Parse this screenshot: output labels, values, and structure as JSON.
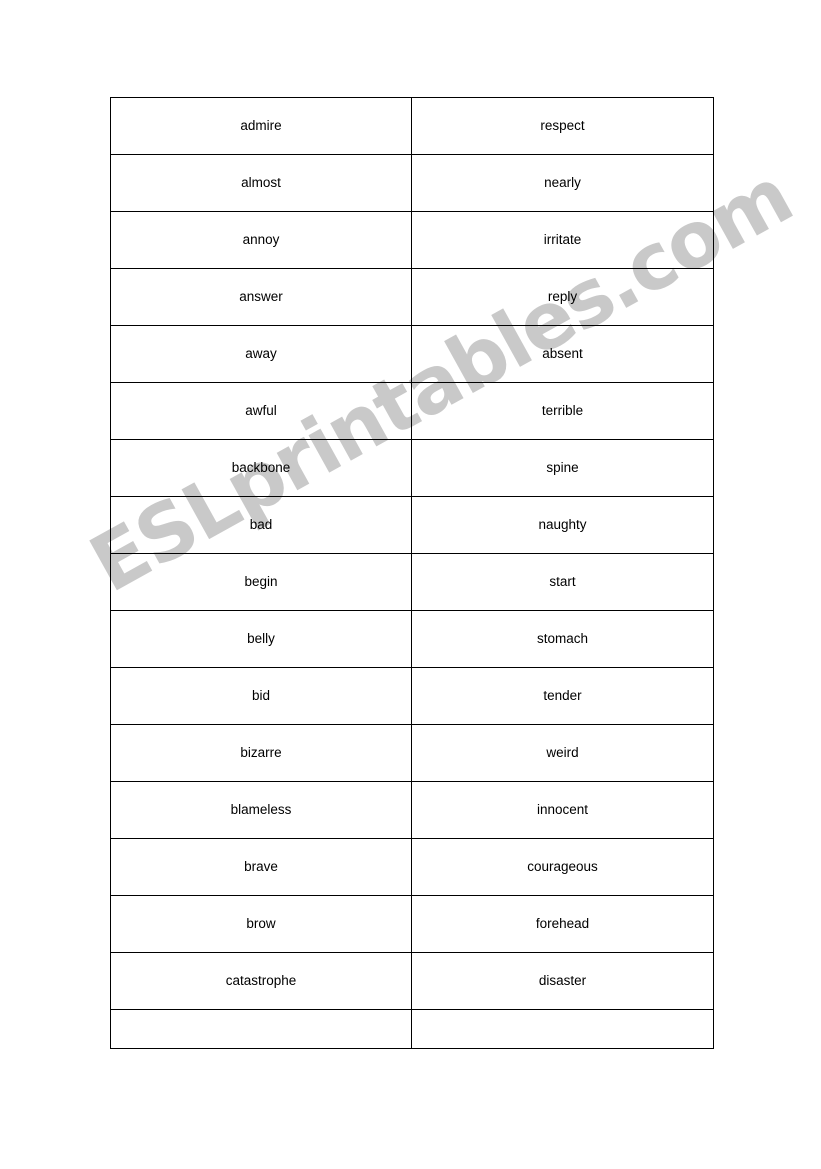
{
  "document": {
    "kind": "esl-worksheet",
    "background_color": "#ffffff",
    "text_color": "#000000",
    "border_color": "#000000"
  },
  "watermark": {
    "text": "ESLprintables.com",
    "color": "#c9c9c9",
    "rotation_degrees": -29
  },
  "table": {
    "columns": 2,
    "column_headers": [
      "",
      ""
    ],
    "rows": [
      {
        "left": "admire",
        "right": "respect"
      },
      {
        "left": "almost",
        "right": "nearly"
      },
      {
        "left": "annoy",
        "right": "irritate"
      },
      {
        "left": "answer",
        "right": "reply"
      },
      {
        "left": "away",
        "right": "absent"
      },
      {
        "left": "awful",
        "right": "terrible"
      },
      {
        "left": "backbone",
        "right": "spine"
      },
      {
        "left": "bad",
        "right": "naughty"
      },
      {
        "left": "begin",
        "right": "start"
      },
      {
        "left": "belly",
        "right": "stomach"
      },
      {
        "left": "bid",
        "right": "tender"
      },
      {
        "left": "bizarre",
        "right": "weird"
      },
      {
        "left": "blameless",
        "right": "innocent"
      },
      {
        "left": "brave",
        "right": "courageous"
      },
      {
        "left": "brow",
        "right": "forehead"
      },
      {
        "left": "catastrophe",
        "right": "disaster"
      }
    ],
    "empty_row": {
      "left": "",
      "right": ""
    }
  }
}
